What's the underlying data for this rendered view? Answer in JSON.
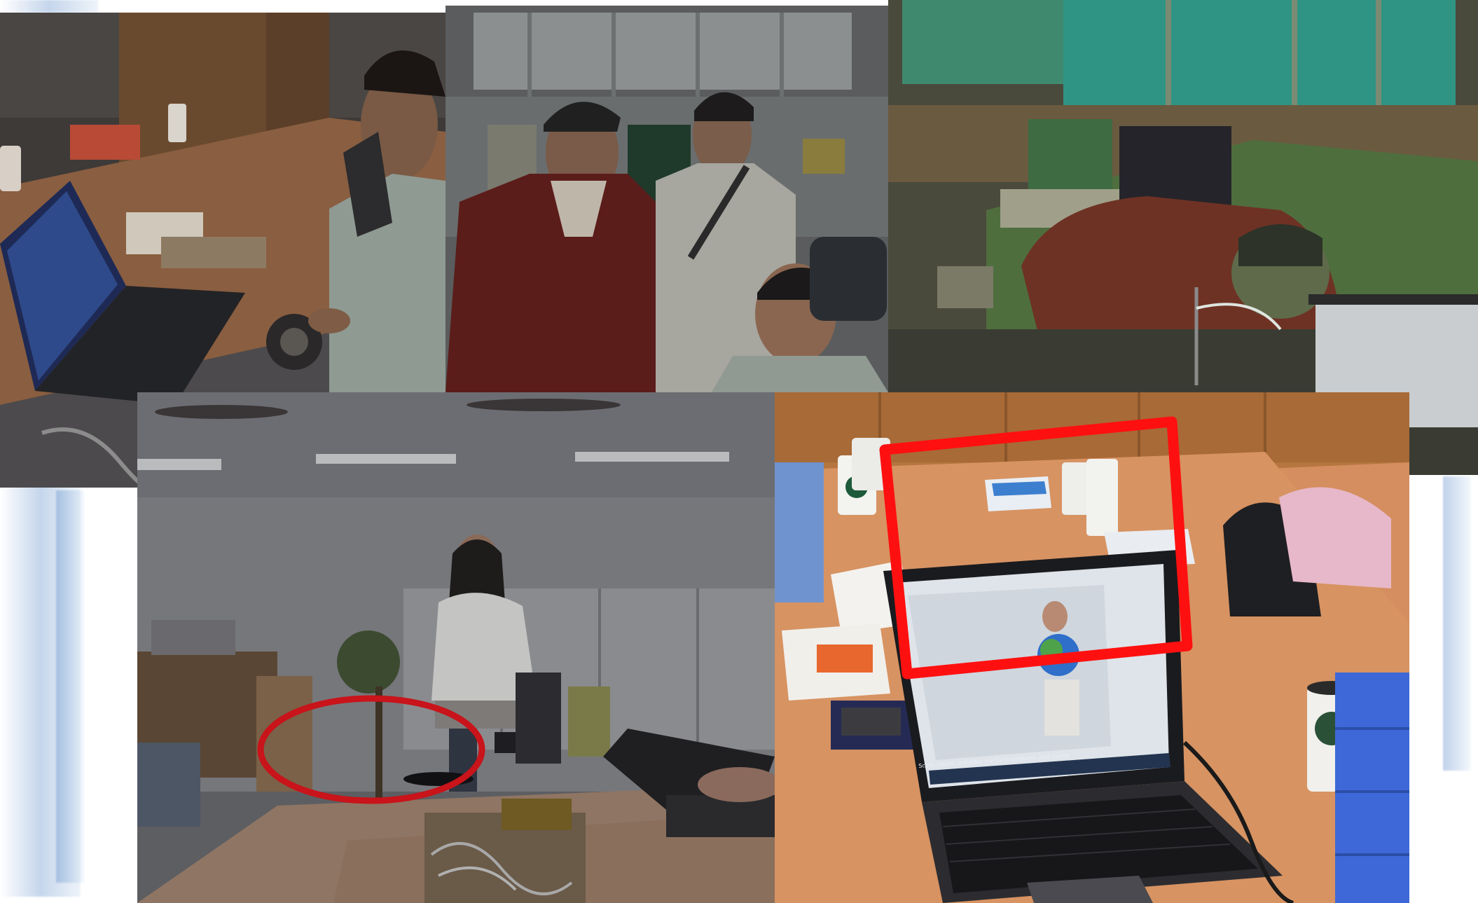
{
  "collage": {
    "description_hidden": "",
    "background_color": "#ffffff",
    "frame_stroke_color": "#9fb8da",
    "photos": [
      {
        "id": "top-left",
        "scene": "man-assembling-device"
      },
      {
        "id": "top-center",
        "scene": "three-men-watching"
      },
      {
        "id": "top-right",
        "scene": "man-leaning-on-desk"
      },
      {
        "id": "bottom-left",
        "scene": "woman-in-office"
      },
      {
        "id": "bottom-right",
        "scene": "laptop-on-desk"
      }
    ],
    "annotations": {
      "ellipse_color": "#c8141a",
      "rectangle_color": "#ff1010"
    },
    "laptop_screen_text": "Scale, rotate, translate the Earth between your hands"
  }
}
